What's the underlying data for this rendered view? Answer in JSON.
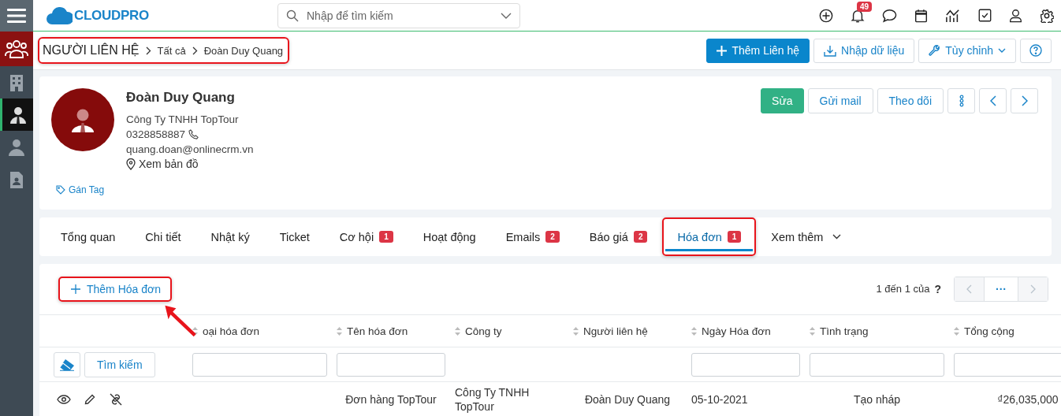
{
  "sidebar": {
    "items": [
      {
        "kind": "module",
        "selected": false
      },
      {
        "kind": "link",
        "selected": false
      },
      {
        "kind": "link",
        "selected": true
      },
      {
        "kind": "link",
        "selected": false
      },
      {
        "kind": "link",
        "selected": false
      }
    ]
  },
  "header": {
    "logo": "CLOUDPRO",
    "search": {
      "placeholder": "Nhập để tìm kiếm"
    },
    "notification_count": "49"
  },
  "breadcrumb": {
    "highlighted": true,
    "items": [
      "NGƯỜI LIÊN HỆ",
      "Tất cả",
      "Đoàn Duy Quang"
    ]
  },
  "page_actions": [
    {
      "label": "Thêm Liên hệ",
      "kind": "primary"
    },
    {
      "label": "Nhập dữ liệu",
      "kind": "import"
    },
    {
      "label": "Tùy chỉnh",
      "kind": "dropdown"
    }
  ],
  "contact": {
    "name": "Đoàn Duy Quang",
    "company": "Công Ty TNHH TopTour",
    "phone": "0328858887",
    "email": "quang.doan@onlinecrm.vn",
    "map_link": "Xem bản đồ",
    "tag_link": "Gán Tag",
    "actions": [
      {
        "label": "Sửa",
        "kind": "primary"
      },
      {
        "label": "Gửi mail",
        "kind": "outline"
      },
      {
        "label": "Theo dõi",
        "kind": "outline"
      }
    ]
  },
  "tabs": [
    {
      "label": "Tổng quan",
      "selected": false,
      "highlighted": false
    },
    {
      "label": "Chi tiết",
      "selected": false,
      "highlighted": false
    },
    {
      "label": "Nhật ký",
      "selected": false,
      "highlighted": false
    },
    {
      "label": "Ticket",
      "selected": false,
      "highlighted": false
    },
    {
      "label": "Cơ hội",
      "badge": "1",
      "selected": false,
      "highlighted": false
    },
    {
      "label": "Hoạt động",
      "selected": false,
      "highlighted": false
    },
    {
      "label": "Emails",
      "badge": "2",
      "selected": false,
      "highlighted": false
    },
    {
      "label": "Báo giá",
      "badge": "2",
      "selected": false,
      "highlighted": false
    },
    {
      "label": "Hóa đơn",
      "badge": "1",
      "selected": true,
      "highlighted": true
    }
  ],
  "more_tab": "Xem thêm",
  "invoices": {
    "add_button": {
      "label": "Thêm Hóa đơn",
      "highlighted": true
    },
    "callout_arrow": true,
    "pagination": {
      "text": "1 đến 1 của",
      "help": "?",
      "ellipsis": "···",
      "prev_disabled": true,
      "next_disabled": true
    },
    "search_button": "Tìm kiếm",
    "columns": [
      {
        "label": "oại hóa đơn",
        "filter": true
      },
      {
        "label": "Tên hóa đơn",
        "filter": true
      },
      {
        "label": "Công ty",
        "filter": false
      },
      {
        "label": "Người liên hệ",
        "filter": false
      },
      {
        "label": "Ngày Hóa đơn",
        "filter": true
      },
      {
        "label": "Tình trạng",
        "filter": true
      },
      {
        "label": "Tổng cộng",
        "filter": true
      }
    ],
    "rows": [
      {
        "cells": [
          "",
          "Đơn hàng TopTour",
          "Công Ty TNHH TopTour",
          "Đoàn Duy Quang",
          "05-10-2021",
          "Tạo nháp",
          "₫26,035,000"
        ]
      }
    ]
  }
}
